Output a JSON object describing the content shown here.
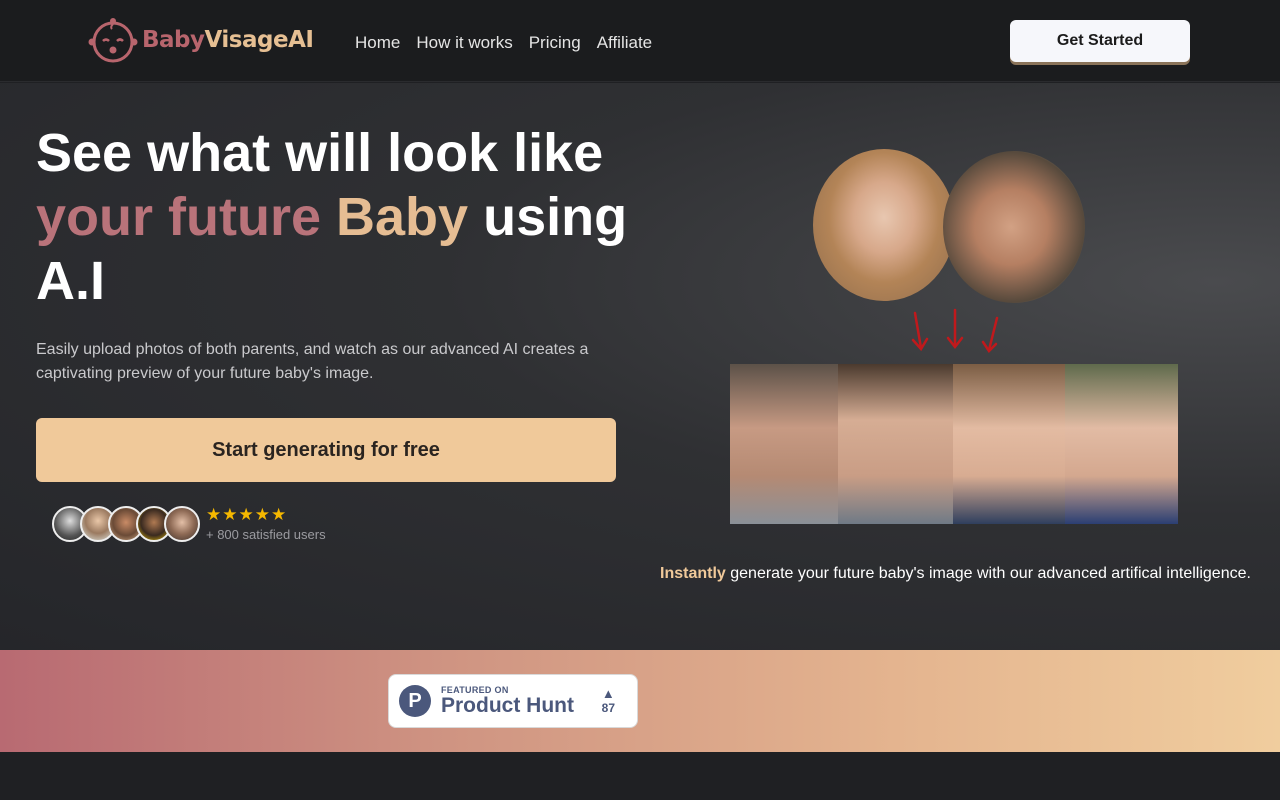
{
  "brand": {
    "name_part1": "Baby",
    "name_part2": "VisageAI",
    "icon": "baby-face-icon",
    "colors": {
      "rose": "#b8656d",
      "peach": "#e6bf93"
    }
  },
  "nav": {
    "links": [
      "Home",
      "How it works",
      "Pricing",
      "Affiliate"
    ],
    "cta_label": "Get Started"
  },
  "hero": {
    "headline_line1": "See what will look like",
    "headline_accent1": "your future",
    "headline_accent2": "Baby",
    "headline_rest": "using",
    "headline_line3": "A.I",
    "subtext": "Easily upload photos of both parents, and watch as our advanced AI creates a captivating preview of your future baby's image.",
    "cta_label": "Start generating for free",
    "rating_stars": 5,
    "stars_text": "★★★★★",
    "users_text": "+ 800 satisfied users",
    "caption_highlight": "Instantly",
    "caption_rest": " generate your future baby's image with our advanced artifical intelligence."
  },
  "product_hunt": {
    "featured_label": "FEATURED ON",
    "name": "Product Hunt",
    "logo_letter": "P",
    "upvote_icon": "upvote-triangle-icon",
    "upvote_glyph": "▲",
    "votes": "87"
  },
  "colors": {
    "cta_bg": "#f0c99a",
    "band_start": "#b86a72",
    "band_end": "#f0cd9e",
    "star": "#f5b800",
    "arrow": "#c0191c"
  }
}
